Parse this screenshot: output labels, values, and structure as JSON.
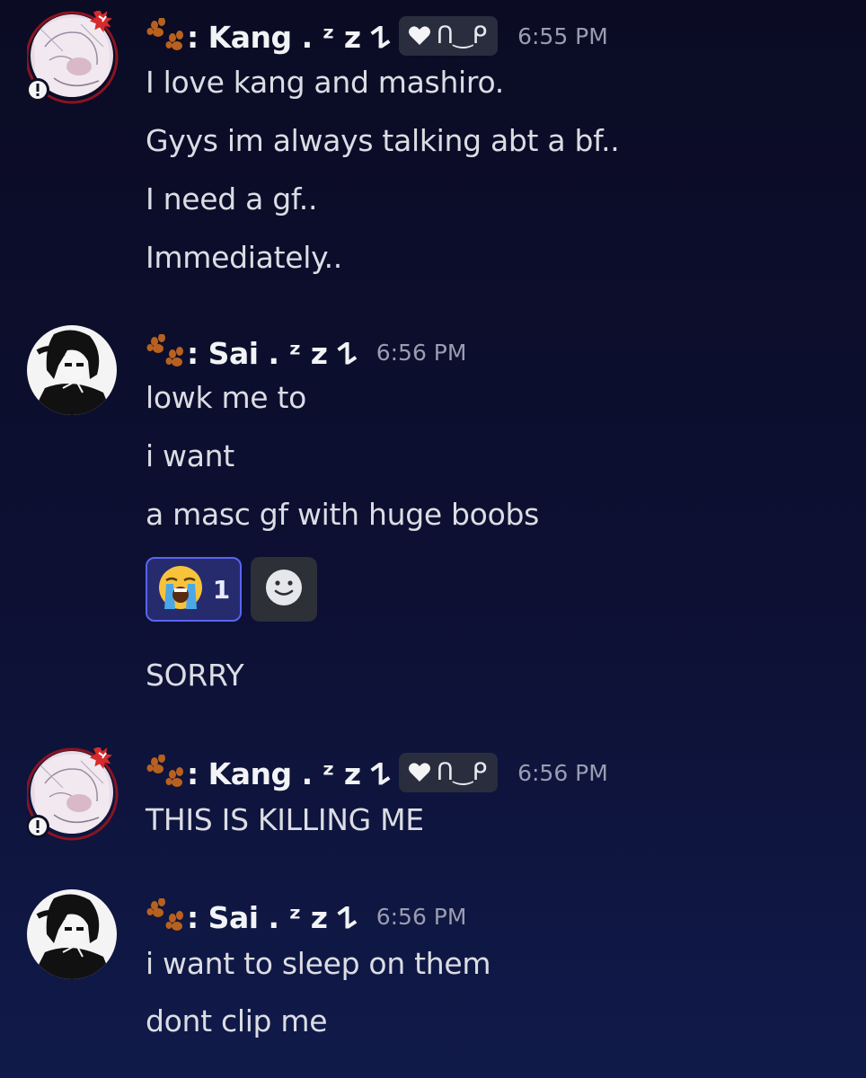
{
  "groups": [
    {
      "author": ": Kang . ᶻ z 𐰁",
      "tag": "ᑎ‿ᑭ",
      "timestamp": "6:55 PM",
      "avatar": "kang-avatar",
      "lines": [
        "I love kang and mashiro.",
        "Gyys im always talking abt a bf..",
        "I need a gf..",
        "Immediately.."
      ]
    },
    {
      "author": ": Sai . ᶻ z 𐰁",
      "timestamp": "6:56 PM",
      "avatar": "sai-avatar",
      "lines": [
        "lowk me to",
        "i want",
        "a masc gf with huge boobs"
      ],
      "reactions": [
        {
          "emoji": "loudly-crying-face",
          "count": "1",
          "active": true
        },
        {
          "emoji": "add-reaction-smiley",
          "count": "",
          "active": false
        }
      ],
      "after_reactions": [
        "SORRY"
      ]
    },
    {
      "author": ": Kang . ᶻ z 𐰁",
      "tag": "ᑎ‿ᑭ",
      "timestamp": "6:56 PM",
      "avatar": "kang-avatar",
      "lines": [
        "THIS IS KILLING ME"
      ]
    },
    {
      "author": ": Sai . ᶻ z 𐰁",
      "timestamp": "6:56 PM",
      "avatar": "sai-avatar",
      "lines": [
        "i want to sleep on them",
        "dont clip me"
      ]
    }
  ],
  "colors": {
    "background_top": "#0b0b24",
    "background_bottom": "#101a4a",
    "reaction_active_border": "#5865f2",
    "reaction_active_bg": "#262b6e",
    "timestamp": "#9a9db0",
    "username": "#f2f3f5"
  }
}
